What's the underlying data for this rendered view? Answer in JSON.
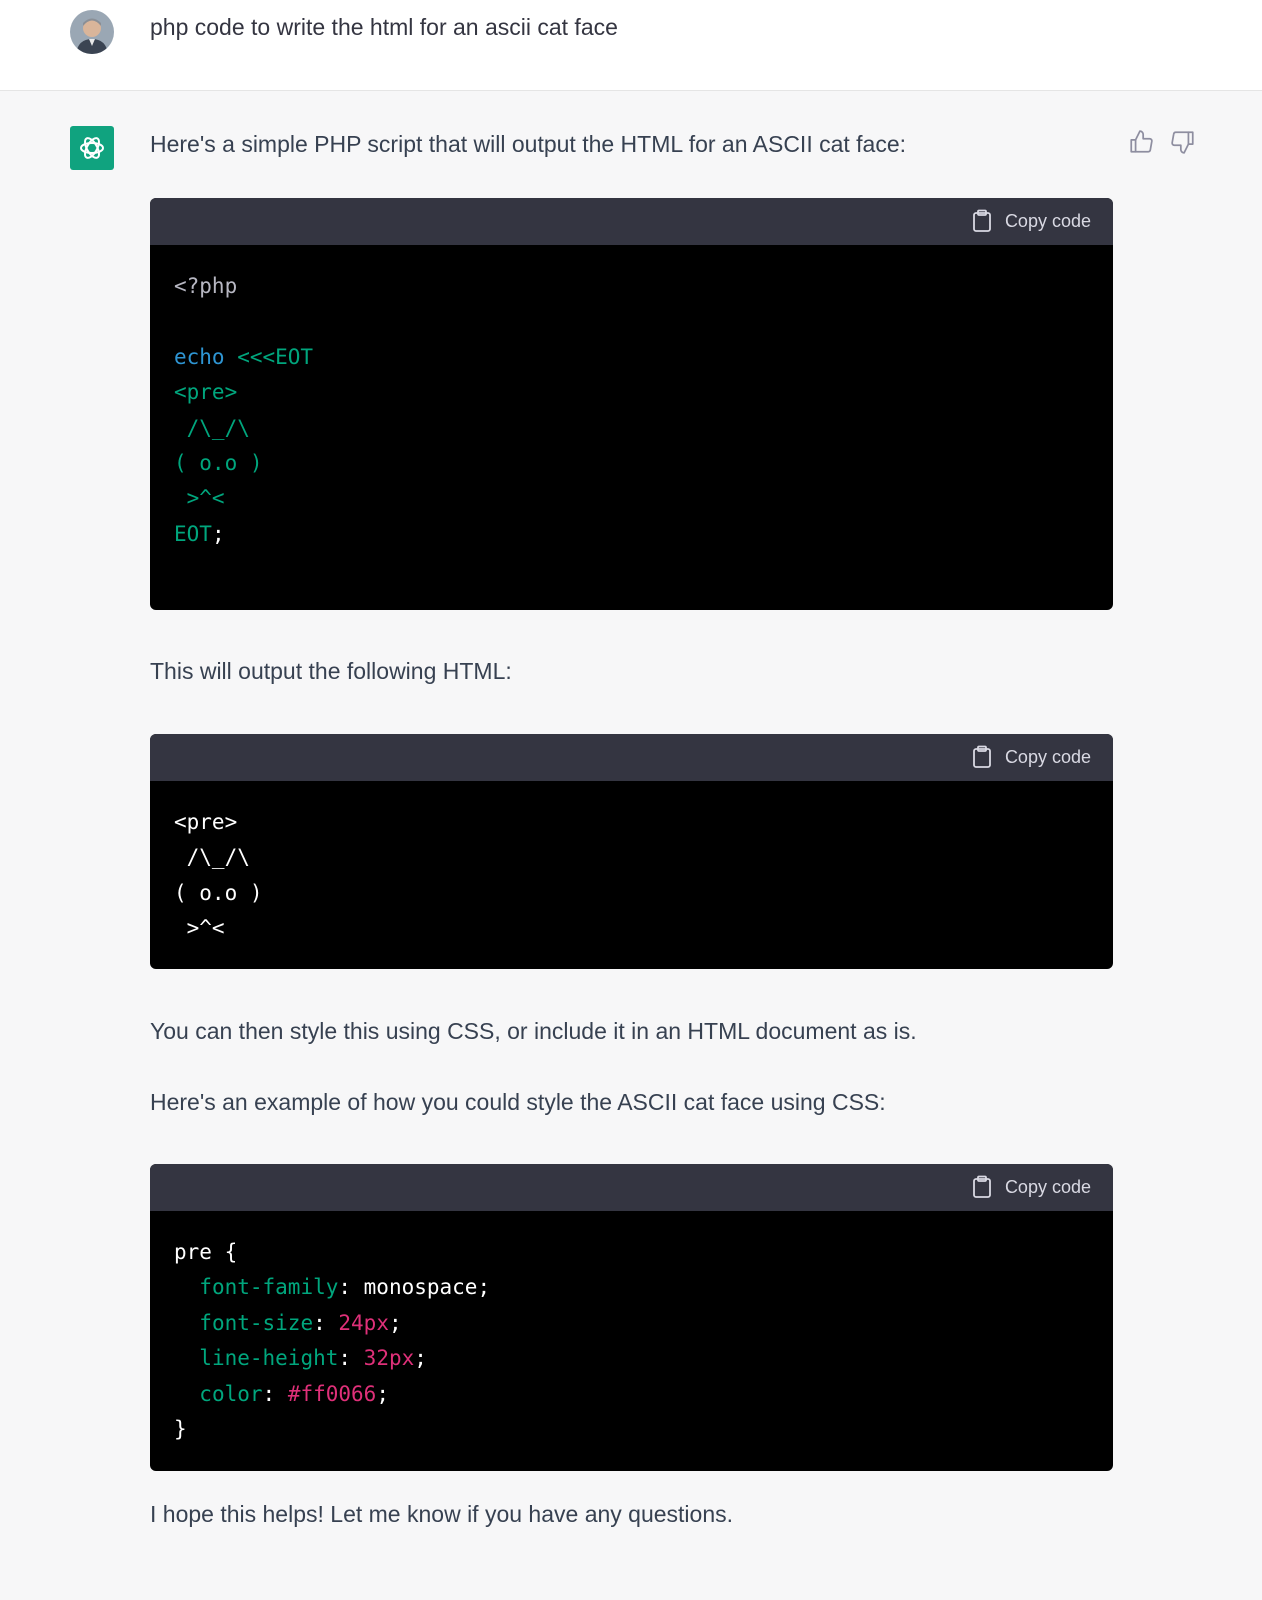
{
  "user": {
    "message": "php code to write the html for an ascii cat face"
  },
  "assistant": {
    "intro": "Here's a simple PHP script that will output the HTML for an ASCII cat face:",
    "copy_label": "Copy code",
    "code1": {
      "lines": [
        "<?php",
        "",
        "echo <<<EOT",
        "<pre>",
        " /\\_/\\",
        "( o.o )",
        " >^<",
        "EOT;"
      ]
    },
    "output_text": "This will output the following HTML:",
    "code2": {
      "lines": [
        "<pre>",
        " /\\_/\\",
        "( o.o )",
        " >^<"
      ]
    },
    "style_text": "You can then style this using CSS, or include it in an HTML document as is.",
    "example_text": "Here's an example of how you could style the ASCII cat face using CSS:",
    "code3": {
      "lines": [
        "pre {",
        "  font-family: monospace;",
        "  font-size: 24px;",
        "  line-height: 32px;",
        "  color: #ff0066;",
        "}"
      ]
    },
    "closing": "I hope this helps! Let me know if you have any questions."
  },
  "icons": [
    "user-avatar",
    "openai-logo-icon",
    "thumbs-up-icon",
    "thumbs-down-icon",
    "clipboard-icon"
  ],
  "colors": {
    "brand": "#10a37f",
    "code_header": "#343541",
    "code_bg": "#000000",
    "syntax_keyword": "#2e95d3",
    "syntax_string": "#00a67d",
    "syntax_value": "#df3079"
  }
}
